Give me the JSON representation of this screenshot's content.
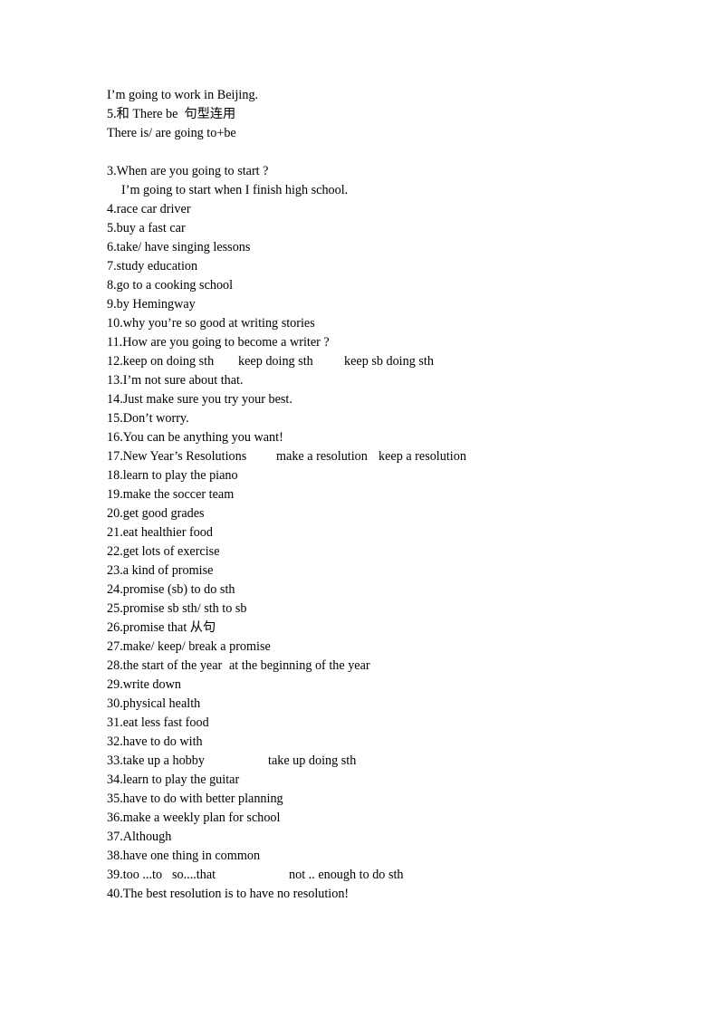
{
  "document": {
    "lines": [
      {
        "id": "l1",
        "text": "I’m going to work in Beijing."
      },
      {
        "id": "l2",
        "text": "5.和 There be  句型连用"
      },
      {
        "id": "l3",
        "text": "There is/ are going to+be"
      },
      {
        "id": "l4",
        "text": ""
      },
      {
        "id": "l5",
        "text": "3.When are you going to start ?"
      },
      {
        "id": "l6",
        "text": "I’m going to start when I finish high school."
      },
      {
        "id": "l7",
        "text": "4.race car driver"
      },
      {
        "id": "l8",
        "text": "5.buy a fast car"
      },
      {
        "id": "l9",
        "text": "6.take/ have singing lessons"
      },
      {
        "id": "l10",
        "text": "7.study education"
      },
      {
        "id": "l11",
        "text": "8.go to a cooking school"
      },
      {
        "id": "l12",
        "text": "9.by Hemingway"
      },
      {
        "id": "l13",
        "text": "10.why you’re so good at writing stories"
      },
      {
        "id": "l14",
        "text": "11.How are you going to become a writer ?"
      },
      {
        "id": "l15",
        "text": "12.keep on doing sth"
      },
      {
        "id": "l16",
        "text": "13.I’m not sure about that."
      },
      {
        "id": "l17",
        "text": "14.Just make sure you try your best."
      },
      {
        "id": "l18",
        "text": "15.Don’t worry."
      },
      {
        "id": "l19",
        "text": "16.You can be anything you want!"
      },
      {
        "id": "l20",
        "text": "17.New Year’s Resolutions"
      },
      {
        "id": "l21",
        "text": "18.learn to play the piano"
      },
      {
        "id": "l22",
        "text": "19.make the soccer team"
      },
      {
        "id": "l23",
        "text": "20.get good grades"
      },
      {
        "id": "l24",
        "text": "21.eat healthier food"
      },
      {
        "id": "l25",
        "text": "22.get lots of exercise"
      },
      {
        "id": "l26",
        "text": "23.a kind of promise"
      },
      {
        "id": "l27",
        "text": "24.promise (sb) to do sth"
      },
      {
        "id": "l28",
        "text": "25.promise sb sth/ sth to sb"
      },
      {
        "id": "l29",
        "text": "26.promise that 从句"
      },
      {
        "id": "l30",
        "text": "27.make/ keep/ break a promise"
      },
      {
        "id": "l31",
        "text": "28.the start of the year"
      },
      {
        "id": "l32",
        "text": "29.write down"
      },
      {
        "id": "l33",
        "text": "30.physical health"
      },
      {
        "id": "l34",
        "text": "31.eat less fast food"
      },
      {
        "id": "l35",
        "text": "32.have to do with"
      },
      {
        "id": "l36",
        "text": "33.take up a hobby"
      },
      {
        "id": "l37",
        "text": "34.learn to play the guitar"
      },
      {
        "id": "l38",
        "text": "35.have to do with better planning"
      },
      {
        "id": "l39",
        "text": "36.make a weekly plan for school"
      },
      {
        "id": "l40",
        "text": "37.Although"
      },
      {
        "id": "l41",
        "text": "38.have one thing in common"
      },
      {
        "id": "l42",
        "text": "39.too ...to"
      },
      {
        "id": "l43",
        "text": "40.The best resolution is to have no resolution!"
      }
    ],
    "extra_columns": {
      "line12_col2": "keep doing sth",
      "line12_col3": "keep sb doing sth",
      "line17_col2": "make a resolution",
      "line17_col3": "keep a resolution",
      "line28_col2": "at the beginning of the year",
      "line33_col2": "take up doing sth",
      "line39_col2": "so....that",
      "line39_col3": "not .. enough to do sth"
    }
  }
}
